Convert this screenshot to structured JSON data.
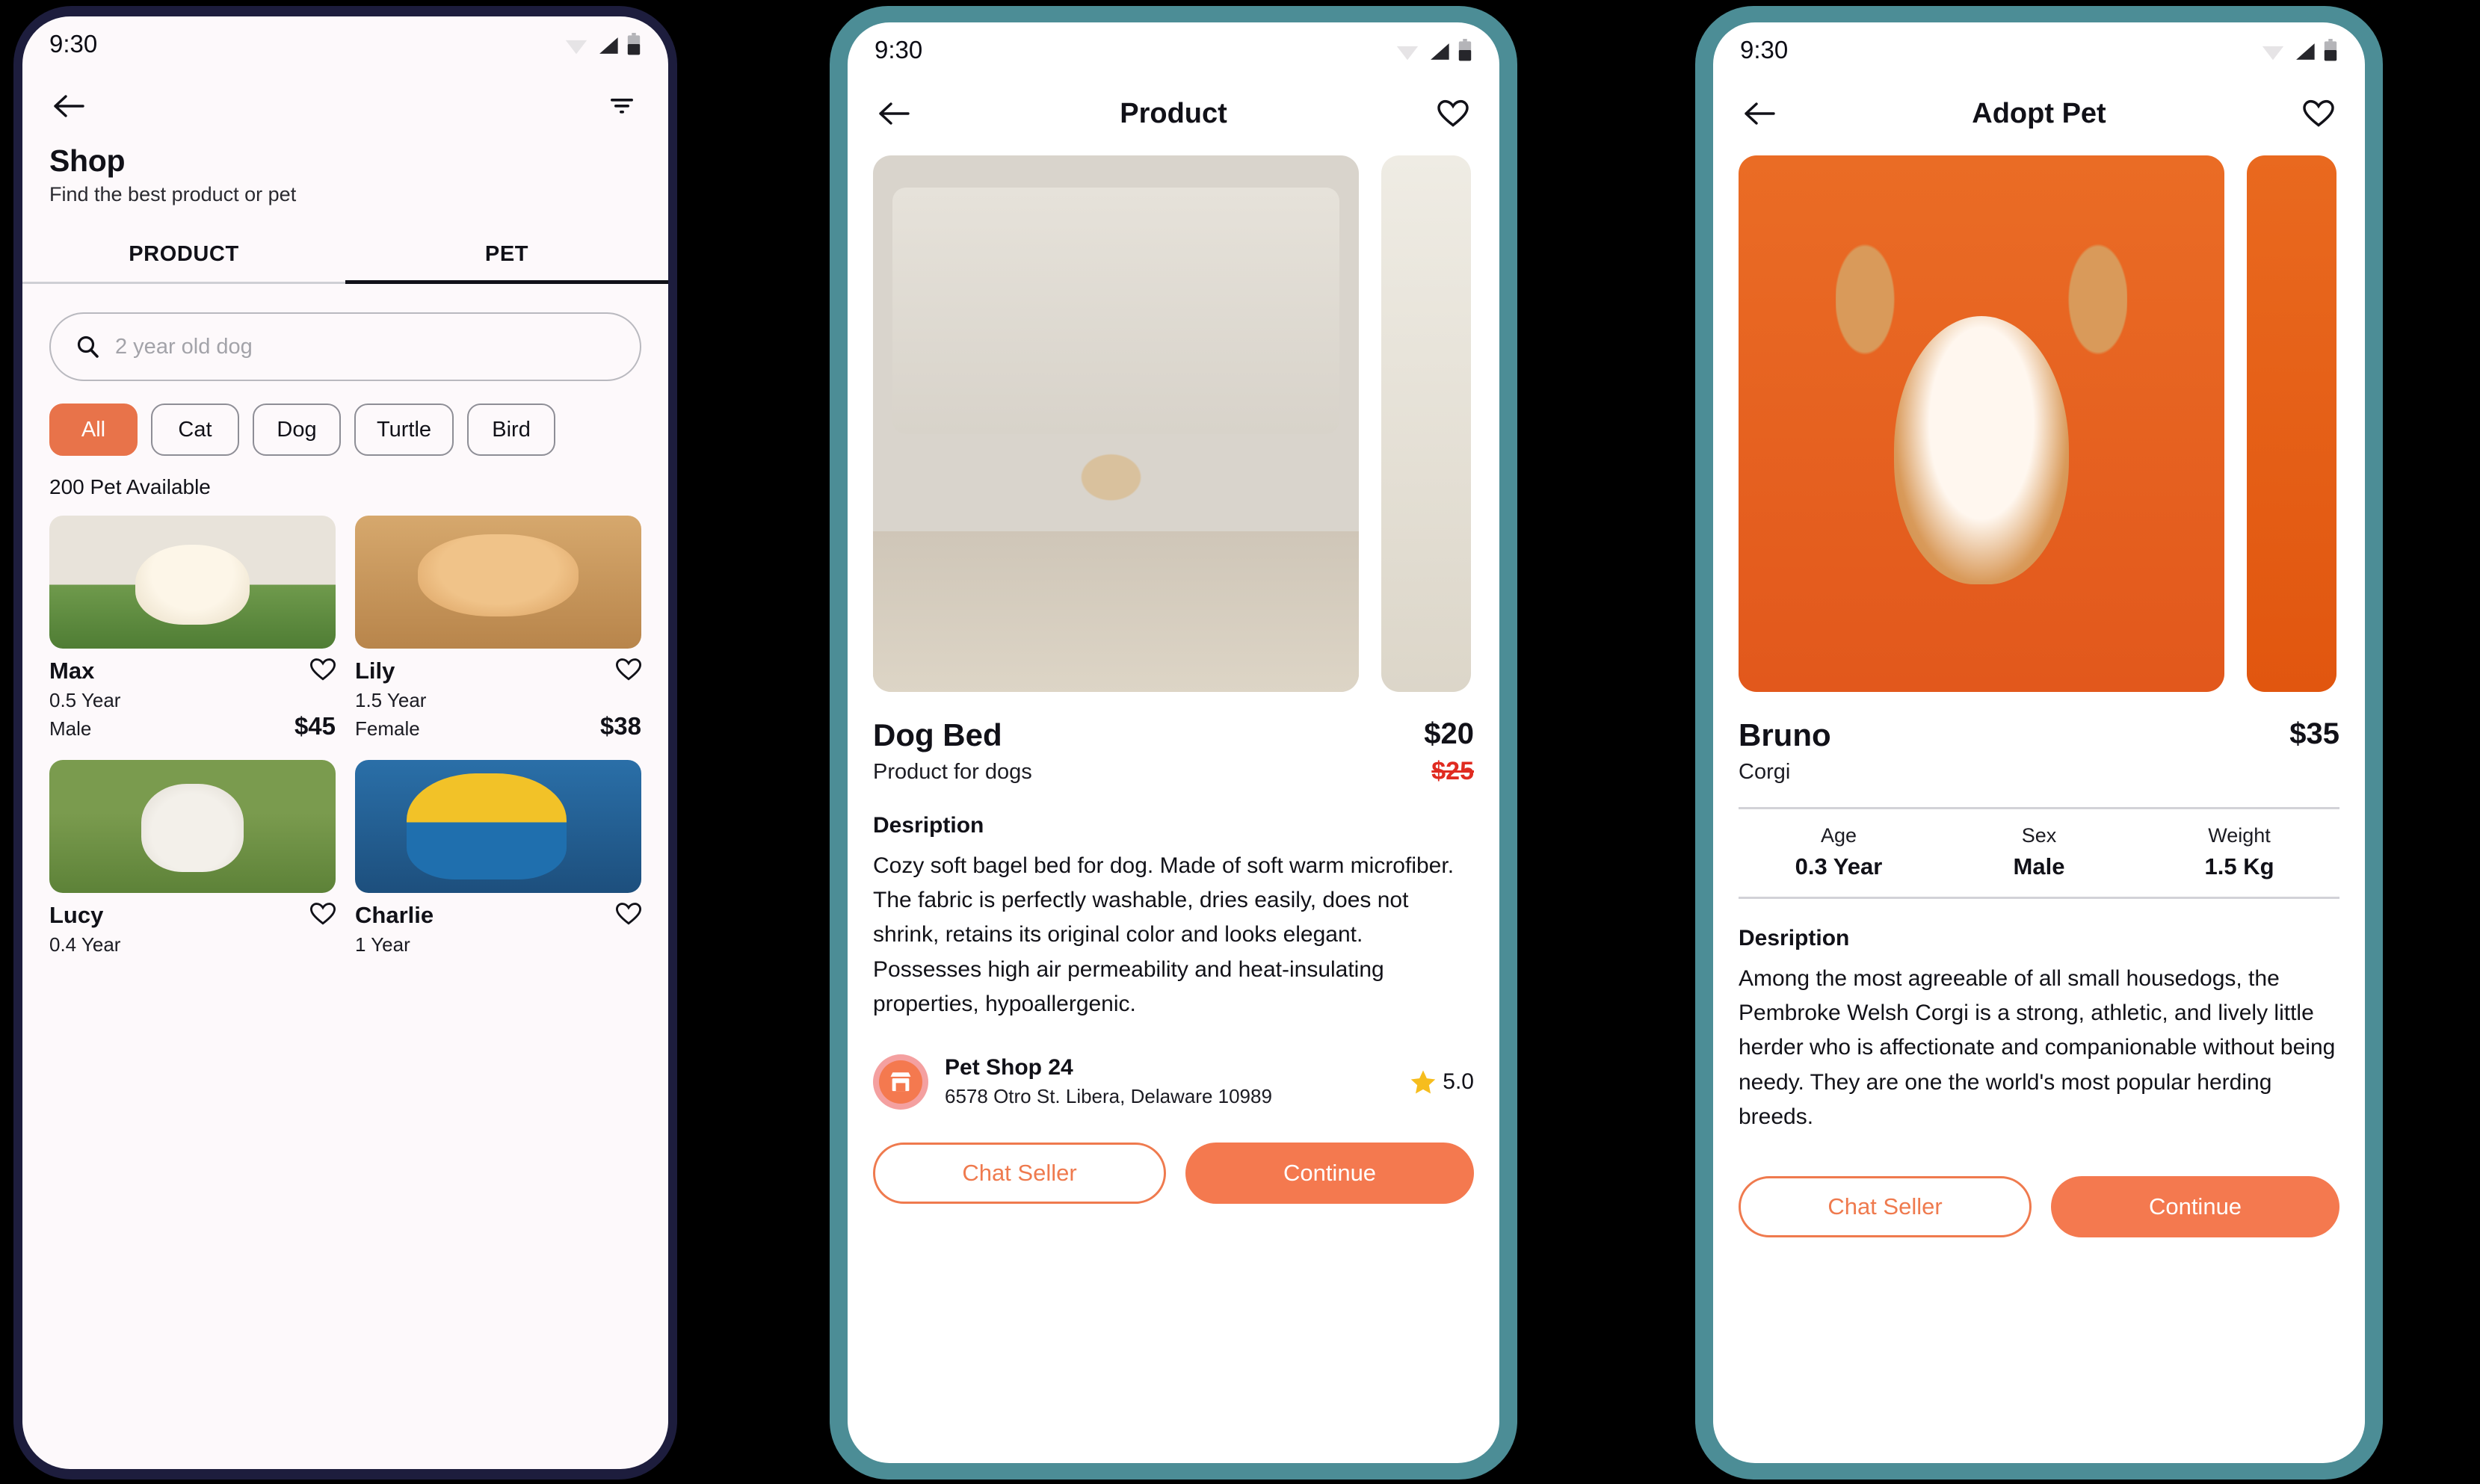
{
  "colors": {
    "accent": "#f4794f",
    "accent_border": "#ef7a4e",
    "sale_red": "#e02b20",
    "star_yellow": "#f6bd1e",
    "frame_navy": "#1d1d3d",
    "frame_teal": "#4c8d96",
    "screen_tint": "#fdf9fb"
  },
  "status_bar": {
    "time": "9:30",
    "icons": [
      "wifi-icon",
      "signal-icon",
      "battery-icon"
    ]
  },
  "phone1": {
    "appbar": {
      "back": "back-arrow-icon",
      "filter": "filter-icon"
    },
    "title": "Shop",
    "subtitle": "Find the best product or pet",
    "tabs": [
      {
        "label": "PRODUCT",
        "active": false
      },
      {
        "label": "PET",
        "active": true
      }
    ],
    "search": {
      "icon": "search-icon",
      "placeholder": "2 year old dog",
      "value": ""
    },
    "chips": [
      {
        "label": "All",
        "selected": true
      },
      {
        "label": "Cat",
        "selected": false
      },
      {
        "label": "Dog",
        "selected": false
      },
      {
        "label": "Turtle",
        "selected": false
      },
      {
        "label": "Bird",
        "selected": false
      }
    ],
    "available": "200 Pet Available",
    "pets": [
      {
        "name": "Max",
        "age": "0.5 Year",
        "sex": "Male",
        "price": "$45",
        "photo": "ph-pup"
      },
      {
        "name": "Lily",
        "age": "1.5 Year",
        "sex": "Female",
        "price": "$38",
        "photo": "ph-cat"
      },
      {
        "name": "Lucy",
        "age": "0.4 Year",
        "sex": "",
        "price": "",
        "photo": "ph-rabbit"
      },
      {
        "name": "Charlie",
        "age": "1 Year",
        "sex": "",
        "price": "",
        "photo": "ph-parrot"
      }
    ]
  },
  "phone2": {
    "appbar": {
      "back": "back-arrow-icon",
      "title": "Product",
      "favorite": "heart-outline-icon"
    },
    "gallery": [
      {
        "photo": "ph-dogbed",
        "alt": "dog-in-orange-bed"
      },
      {
        "photo": "ph-sofa",
        "alt": "living-room-second-photo"
      }
    ],
    "name": "Dog Bed",
    "subtitle": "Product for dogs",
    "price": "$20",
    "old_price": "$25",
    "description_heading": "Desription",
    "description": "Cozy soft bagel bed for dog. Made of soft warm microfiber. The fabric is perfectly washable, dries easily, does not shrink, retains its original color and looks elegant. Possesses high air permeability and heat-insulating properties, hypoallergenic.",
    "seller": {
      "icon": "storefront-icon",
      "name": "Pet Shop 24",
      "address": "6578 Otro St. Libera, Delaware 10989",
      "rating": "5.0",
      "rating_icon": "star-icon"
    },
    "buttons": {
      "secondary": "Chat Seller",
      "primary": "Continue"
    }
  },
  "phone3": {
    "appbar": {
      "back": "back-arrow-icon",
      "title": "Adopt Pet",
      "favorite": "heart-outline-icon"
    },
    "gallery": [
      {
        "photo": "ph-corgi",
        "alt": "corgi-puppy-on-orange"
      },
      {
        "photo": "ph-orange",
        "alt": "second-photo"
      }
    ],
    "name": "Bruno",
    "subtitle": "Corgi",
    "price": "$35",
    "stats": [
      {
        "key": "Age",
        "value": "0.3 Year"
      },
      {
        "key": "Sex",
        "value": "Male"
      },
      {
        "key": "Weight",
        "value": "1.5 Kg"
      }
    ],
    "description_heading": "Desription",
    "description": " Among the most agreeable of all small housedogs, the Pembroke Welsh Corgi is a strong, athletic, and lively little herder who is affectionate and companionable without being needy. They are one the world's most popular herding breeds.",
    "buttons": {
      "secondary": "Chat Seller",
      "primary": "Continue"
    }
  }
}
